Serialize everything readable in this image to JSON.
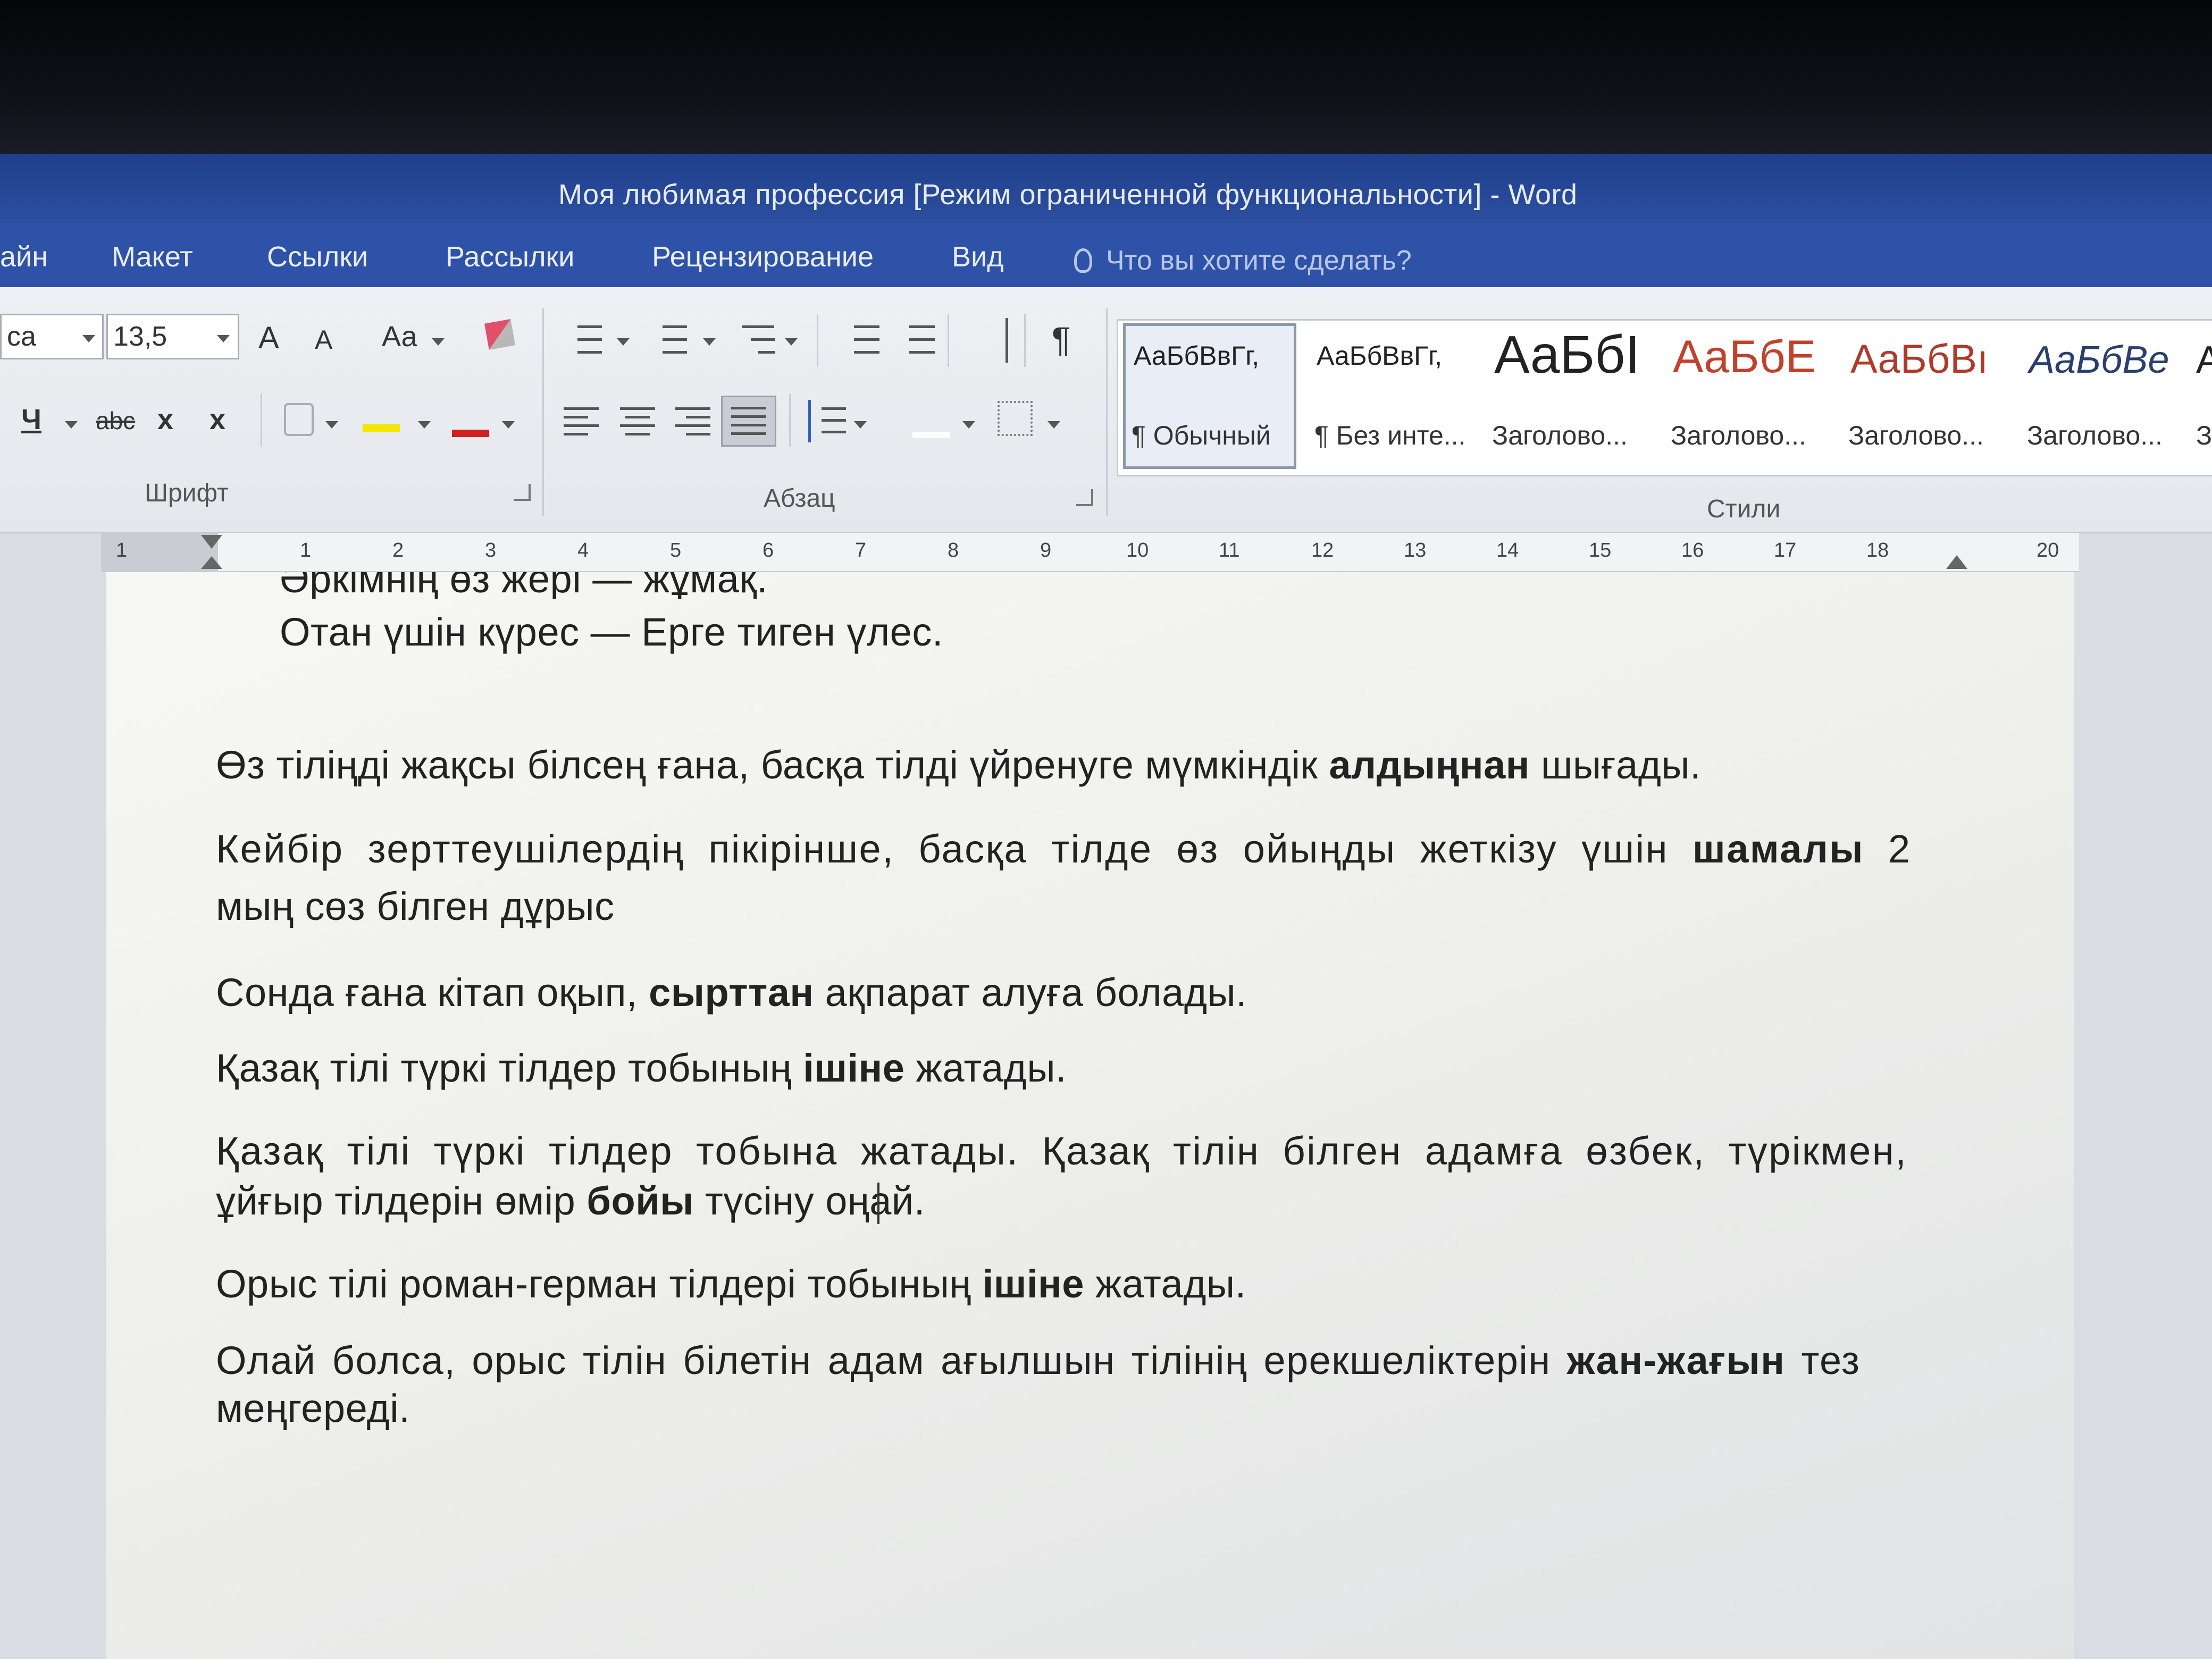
{
  "window": {
    "title": "Моя любимая профессия [Режим ограниченной функциональности] - Word"
  },
  "tabs": {
    "items": [
      "айн",
      "Макет",
      "Ссылки",
      "Рассылки",
      "Рецензирование",
      "Вид"
    ],
    "tell_me": "Что вы хотите сделать?"
  },
  "ribbon": {
    "font": {
      "name": "са",
      "size": "13,5",
      "grow_label": "A",
      "shrink_label": "A",
      "case_label": "Аа",
      "underline_label": "Ч",
      "strike_label": "abc",
      "sub_label": "x",
      "super_label": "x",
      "group_label": "Шрифт"
    },
    "paragraph": {
      "group_label": "Абзац",
      "pilcrow": "¶"
    },
    "styles": {
      "group_label": "Стили",
      "items": [
        {
          "sample": "АаБбВвГг,",
          "name": "¶ Обычный"
        },
        {
          "sample": "АаБбВвГг,",
          "name": "¶ Без инте..."
        },
        {
          "sample": "АаБбI",
          "name": "Заголово..."
        },
        {
          "sample": "АаБбЕ",
          "name": "Заголово..."
        },
        {
          "sample": "АаБбВı",
          "name": "Заголово..."
        },
        {
          "sample": "АаБбВе",
          "name": "Заголово..."
        },
        {
          "sample": "А",
          "name": "З"
        }
      ]
    }
  },
  "ruler": {
    "numbers": [
      "1",
      "1",
      "2",
      "3",
      "4",
      "5",
      "6",
      "7",
      "8",
      "9",
      "10",
      "11",
      "12",
      "13",
      "14",
      "15",
      "16",
      "17",
      "18",
      "20"
    ]
  },
  "document": {
    "partial_line": "Әркімнің өз жері — жұмақ.",
    "line2": "Отан үшін күрес — Ерге тиген үлес.",
    "p1_a": "Өз тіліңді жақсы білсең ғана, басқа тілді үйренуге мүмкіндік ",
    "p1_b": "алдыңнан",
    "p1_c": " шығады.",
    "p2_l1_a": "Кейбір зерттеушілердің пікірінше, басқа тілде өз ойыңды жеткізу үшін ",
    "p2_l1_b": "шамалы",
    "p2_l1_c": " 2",
    "p2_l2": "мың сөз білген дұрыс",
    "p3_a": "Сонда ғана кітап оқып, ",
    "p3_b": "сырттан",
    "p3_c": " ақпарат алуға болады.",
    "p4_a": "Қазақ тілі түркі тілдер тобының ",
    "p4_b": "ішіне",
    "p4_c": " жатады.",
    "p5_l1": "Қазақ тілі түркі тілдер тобына жатады. Қазақ тілін білген адамға өзбек, түрікмен,",
    "p5_l2_a": "ұйғыр тілдерін өмір ",
    "p5_l2_b": "бойы",
    "p5_l2_c": " түсіну оңай.",
    "p6_a": "Орыс тілі роман-герман тілдері тобының ",
    "p6_b": "ішіне",
    "p6_c": " жатады.",
    "p7_l1_a": "Олай болса, орыс тілін білетін адам ағылшын тілінің ерекшеліктерін ",
    "p7_l1_b": "жан-жағын",
    "p7_l1_c": " тез",
    "p7_l2": "меңгереді."
  }
}
